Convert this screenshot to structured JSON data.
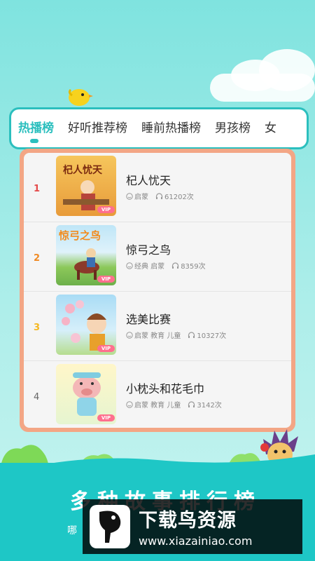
{
  "tabs": [
    {
      "label": "热播榜",
      "active": true
    },
    {
      "label": "好听推荐榜",
      "active": false
    },
    {
      "label": "睡前热播榜",
      "active": false
    },
    {
      "label": "男孩榜",
      "active": false
    },
    {
      "label": "女",
      "active": false
    }
  ],
  "items": [
    {
      "rank": "1",
      "rank_color": "#e44a4a",
      "title": "杞人忧天",
      "tags": "启蒙",
      "plays": "61202次",
      "vip": "VIP",
      "thumb_text": "杞人忧天"
    },
    {
      "rank": "2",
      "rank_color": "#f08a24",
      "title": "惊弓之鸟",
      "tags": "经典 启蒙",
      "plays": "8359次",
      "vip": "VIP",
      "thumb_text": "惊弓之鸟"
    },
    {
      "rank": "3",
      "rank_color": "#f5b820",
      "title": "选美比赛",
      "tags": "启蒙 教育 儿童",
      "plays": "10327次",
      "vip": "VIP"
    },
    {
      "rank": "4",
      "rank_color": "#666666",
      "title": "小枕头和花毛巾",
      "tags": "启蒙 教育 儿童",
      "plays": "3142次",
      "vip": "VIP"
    }
  ],
  "banner": {
    "title": "多种故事排行榜",
    "subtitle": "哪"
  },
  "watermark": {
    "title": "下载鸟资源",
    "url": "www.xiazainiao.com"
  },
  "colors": {
    "accent": "#2bbfbe",
    "frame": "#f3a685",
    "vip": "#ff6f8e"
  }
}
